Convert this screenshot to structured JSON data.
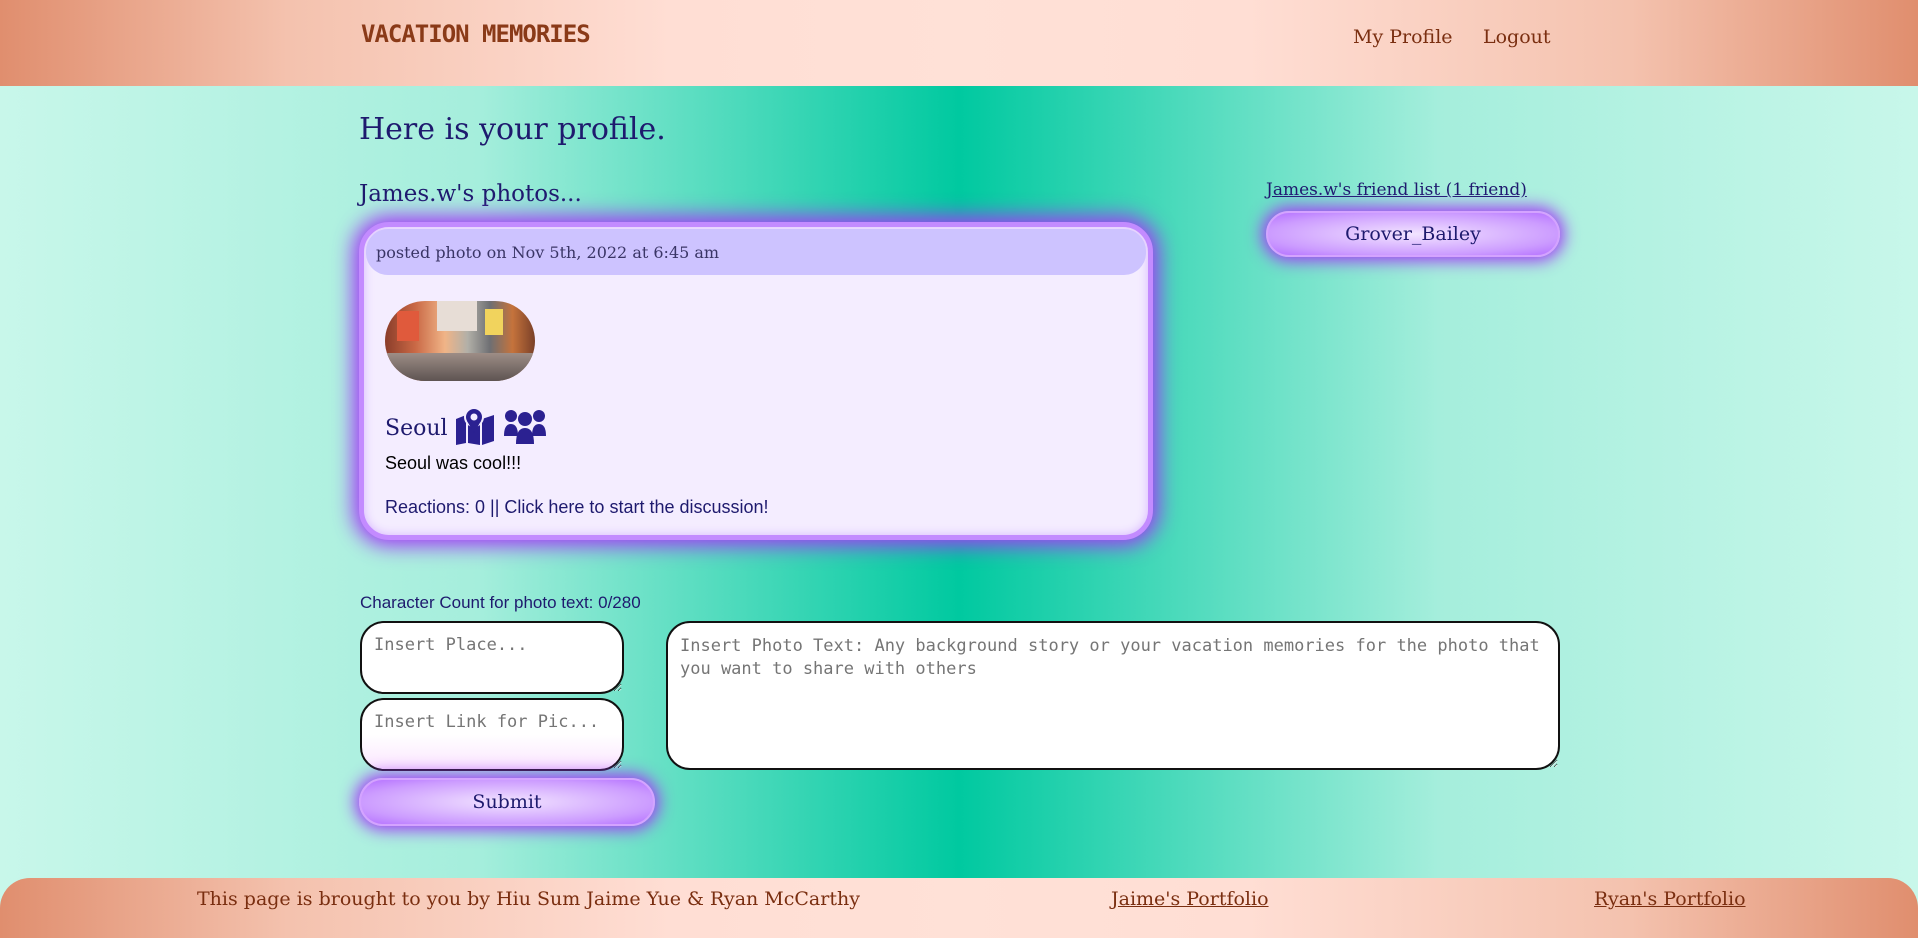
{
  "header": {
    "brand": "VACATION MEMORIES",
    "nav": {
      "profile_label": "My Profile",
      "logout_label": "Logout"
    }
  },
  "main": {
    "title": "Here is your profile.",
    "photos_heading": "James.w's photos...",
    "post": {
      "posted_text": "posted photo on Nov 5th, 2022 at 6:45 am",
      "place": "Seoul",
      "text": "Seoul was cool!!!",
      "reactions_text": "Reactions: 0 || Click here to start the discussion!",
      "icons": [
        "map-location-icon",
        "people-group-icon"
      ]
    }
  },
  "friends": {
    "title": "James.w's friend list (1 friend)",
    "list": [
      "Grover_Bailey"
    ]
  },
  "form": {
    "char_count_text": "Character Count for photo text: 0/280",
    "place_placeholder": "Insert Place...",
    "link_placeholder": "Insert Link for Pic...",
    "text_placeholder": "Insert Photo Text: Any background story or your vacation memories for the photo that you want to share with others",
    "submit_label": "Submit"
  },
  "footer": {
    "credit": "This page is brought to you by Hiu Sum Jaime Yue & Ryan McCarthy",
    "jaime_link": "Jaime's Portfolio",
    "ryan_link": "Ryan's Portfolio"
  },
  "colors": {
    "accent_purple": "#a13af5",
    "text_navy": "#1e1a6e",
    "teal_center": "#00c9a0",
    "header_peach": "#ffded4"
  }
}
